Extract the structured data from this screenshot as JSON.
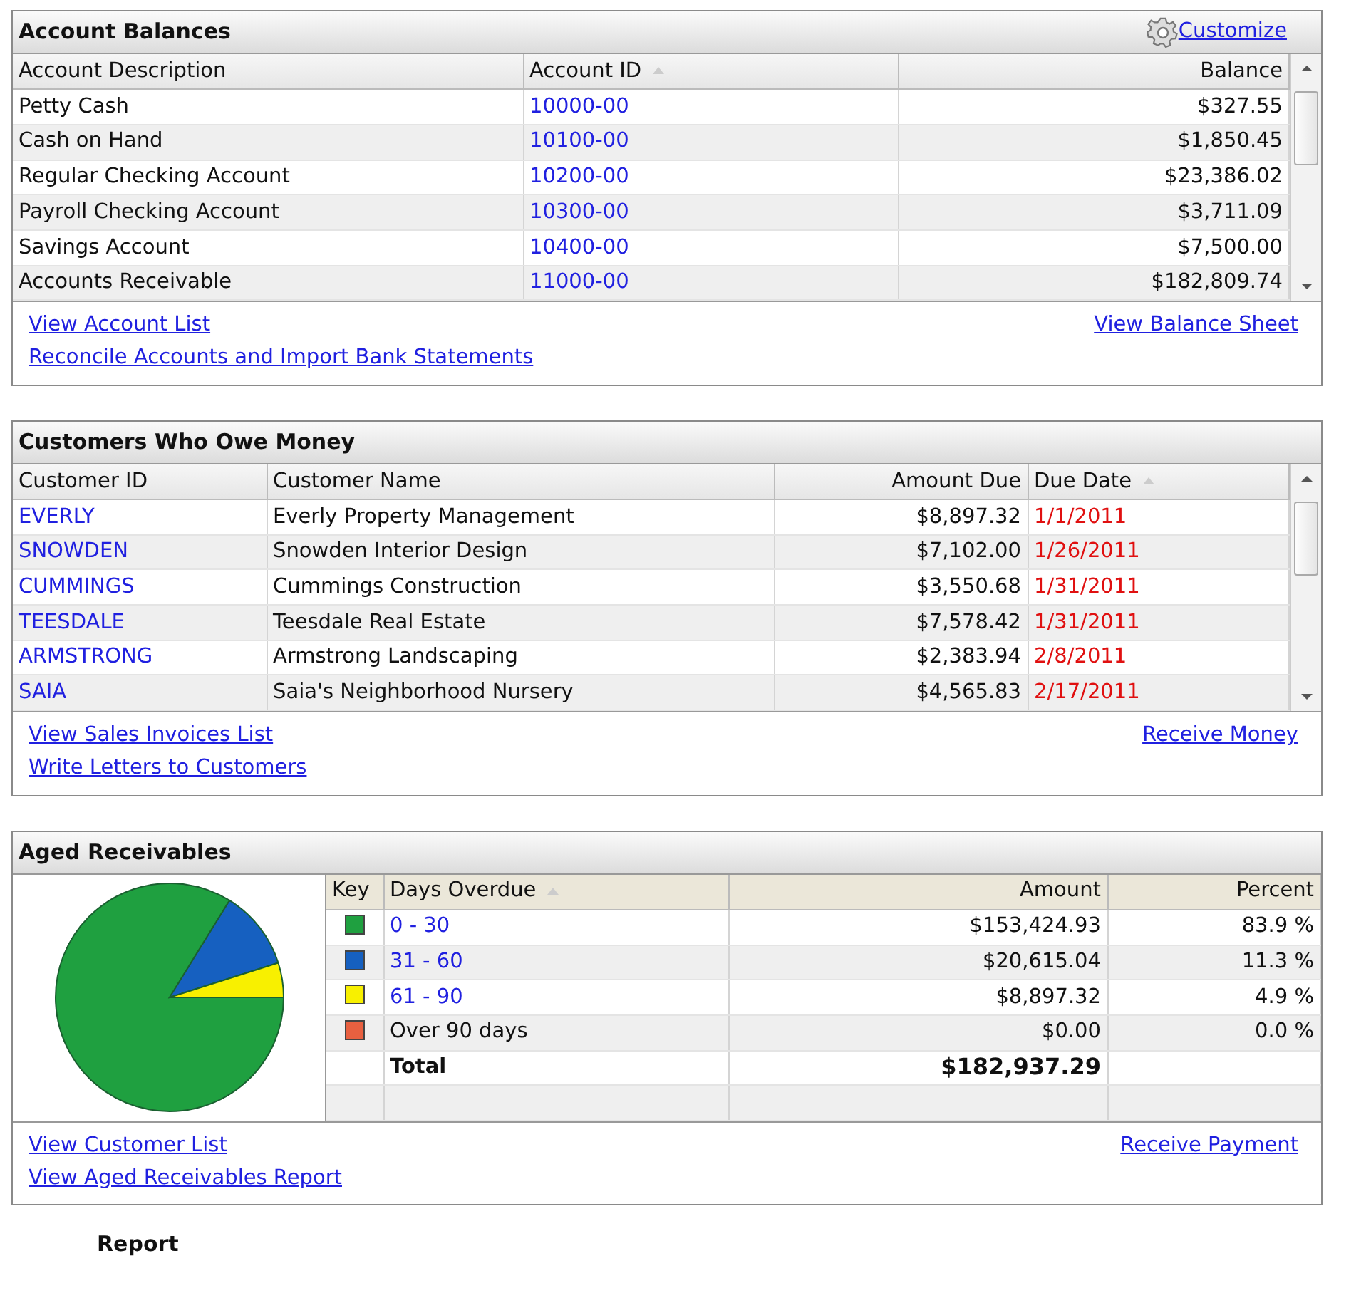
{
  "account_balances": {
    "title": "Account Balances",
    "customize": "Customize",
    "columns": [
      {
        "label": "Account Description",
        "sorted": false
      },
      {
        "label": "Account ID",
        "sorted": true
      },
      {
        "label": "Balance",
        "sorted": false
      }
    ],
    "rows": [
      {
        "description": "Petty Cash",
        "id": "10000-00",
        "balance": "$327.55"
      },
      {
        "description": "Cash on Hand",
        "id": "10100-00",
        "balance": "$1,850.45"
      },
      {
        "description": "Regular Checking Account",
        "id": "10200-00",
        "balance": "$23,386.02"
      },
      {
        "description": "Payroll Checking Account",
        "id": "10300-00",
        "balance": "$3,711.09"
      },
      {
        "description": "Savings Account",
        "id": "10400-00",
        "balance": "$7,500.00"
      },
      {
        "description": "Accounts Receivable",
        "id": "11000-00",
        "balance": "$182,809.74"
      }
    ],
    "links_left": [
      "View Account List",
      "Reconcile Accounts and Import Bank Statements"
    ],
    "links_right": [
      "View Balance Sheet"
    ]
  },
  "customers_who_owe_money": {
    "title": "Customers Who Owe Money",
    "columns": [
      {
        "label": "Customer ID",
        "sorted": false
      },
      {
        "label": "Customer Name",
        "sorted": false
      },
      {
        "label": "Amount Due",
        "sorted": false
      },
      {
        "label": "Due Date",
        "sorted": true
      }
    ],
    "rows": [
      {
        "id": "EVERLY",
        "name": "Everly Property Management",
        "amount": "$8,897.32",
        "due": "1/1/2011",
        "overdue": true
      },
      {
        "id": "SNOWDEN",
        "name": "Snowden Interior Design",
        "amount": "$7,102.00",
        "due": "1/26/2011",
        "overdue": true
      },
      {
        "id": "CUMMINGS",
        "name": "Cummings Construction",
        "amount": "$3,550.68",
        "due": "1/31/2011",
        "overdue": true
      },
      {
        "id": "TEESDALE",
        "name": "Teesdale Real Estate",
        "amount": "$7,578.42",
        "due": "1/31/2011",
        "overdue": true
      },
      {
        "id": "ARMSTRONG",
        "name": "Armstrong Landscaping",
        "amount": "$2,383.94",
        "due": "2/8/2011",
        "overdue": true
      },
      {
        "id": "SAIA",
        "name": "Saia's Neighborhood Nursery",
        "amount": "$4,565.83",
        "due": "2/17/2011",
        "overdue": true
      }
    ],
    "links_left": [
      "View Sales Invoices List",
      "Write Letters to Customers"
    ],
    "links_right": [
      "Receive Money"
    ]
  },
  "aged_receivables": {
    "title": "Aged Receivables",
    "columns": [
      {
        "label": "Key",
        "sorted": false
      },
      {
        "label": "Days Overdue",
        "sorted": true
      },
      {
        "label": "Amount",
        "sorted": false
      },
      {
        "label": "Percent",
        "sorted": false
      }
    ],
    "rows": [
      {
        "days": "0 - 30",
        "link": true,
        "amount": "$153,424.93",
        "percent": "83.9 %",
        "color": "#1fa040"
      },
      {
        "days": "31 - 60",
        "link": true,
        "amount": "$20,615.04",
        "percent": "11.3 %",
        "color": "#1660c0"
      },
      {
        "days": "61 - 90",
        "link": true,
        "amount": "$8,897.32",
        "percent": "4.9 %",
        "color": "#f8f000"
      },
      {
        "days": "Over 90 days",
        "link": false,
        "amount": "$0.00",
        "percent": "0.0 %",
        "color": "#e86040"
      }
    ],
    "total": {
      "label": "Total",
      "amount": "$182,937.29"
    },
    "links_left": [
      "View Customer List",
      "View Aged Receivables Report"
    ],
    "links_right": [
      "Receive Payment"
    ]
  },
  "next_panel_title": "Report"
}
